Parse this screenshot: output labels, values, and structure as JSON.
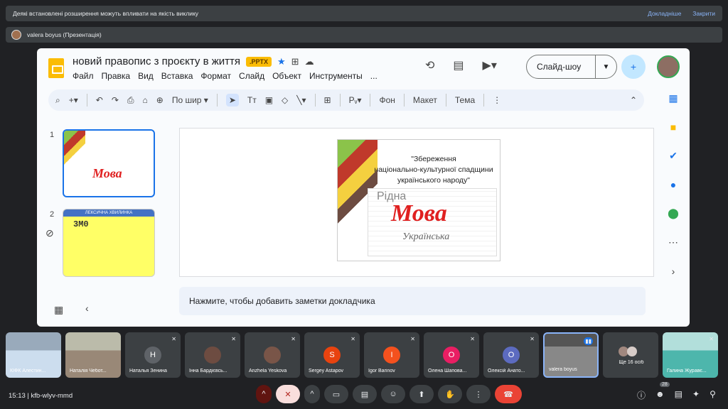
{
  "warning": {
    "text": "Деякі встановлені розширення можуть впливати на якість виклику",
    "details": "Докладніше",
    "close": "Закрити"
  },
  "presenter": {
    "label": "valera boyus (Презентація)"
  },
  "slides_app": {
    "title": "новий правопис з проєкту в життя",
    "format_badge": ".PPTX",
    "menus": [
      "Файл",
      "Правка",
      "Вид",
      "Вставка",
      "Формат",
      "Слайд",
      "Объект",
      "Инструменты",
      "..."
    ],
    "slideshow": "Слайд-шоу",
    "toolbar": {
      "zoom": "По шир",
      "bg": "Фон",
      "layout": "Макет",
      "theme": "Тема"
    },
    "thumbs": [
      {
        "num": "1"
      },
      {
        "num": "2",
        "header": "ЛЕКСИЧНА ХВИЛИНКА",
        "text": "3М0"
      }
    ],
    "slide": {
      "line1": "\"Збереження",
      "line2": "національно-культурної спадщини",
      "line3": "українського народу\"",
      "word_main": "Мова",
      "word_sub": "Українська",
      "word_ridna": "Рідна"
    },
    "notes_placeholder": "Нажмите, чтобы добавить заметки докладчика"
  },
  "participants": [
    {
      "name": "КІФК Алестин...",
      "initial": "",
      "color": "",
      "photo": true
    },
    {
      "name": "Наталія Чебот...",
      "initial": "",
      "color": "",
      "photo": true
    },
    {
      "name": "Наталья Зенина",
      "initial": "Н",
      "color": "#5f6368"
    },
    {
      "name": "Інна Бардієвсь...",
      "initial": "",
      "color": "#6d4c41"
    },
    {
      "name": "Anzhela Yeskova",
      "initial": "",
      "color": "#795548"
    },
    {
      "name": "Sergey Astapov",
      "initial": "S",
      "color": "#e8430f"
    },
    {
      "name": "Igor Barinov",
      "initial": "I",
      "color": "#f4511e"
    },
    {
      "name": "Олена Шапова...",
      "initial": "О",
      "color": "#e91e63"
    },
    {
      "name": "Олексій Анато...",
      "initial": "О",
      "color": "#5c6bc0"
    },
    {
      "name": "valera boyus",
      "initial": "",
      "color": "",
      "photo": true
    },
    {
      "name": "Ще 16 осіб",
      "initial": "",
      "color": ""
    },
    {
      "name": "Галина Журавє...",
      "initial": "",
      "color": "",
      "photo": true
    }
  ],
  "bottom": {
    "time": "15:13",
    "separator": "|",
    "code": "kfb-wlyv-mmd",
    "badge": "28"
  }
}
